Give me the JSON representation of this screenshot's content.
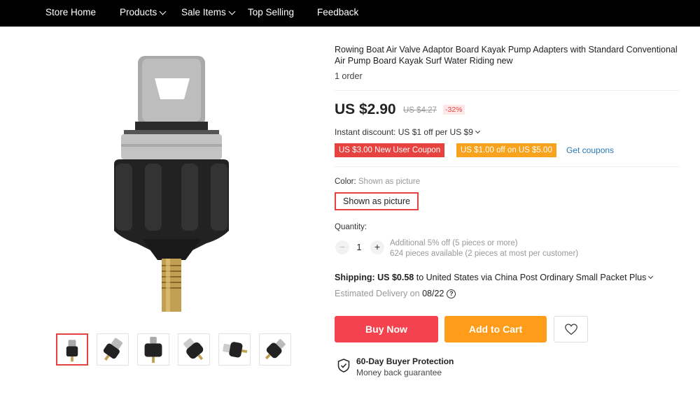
{
  "nav": {
    "items": [
      {
        "label": "Store Home"
      },
      {
        "label": "Products"
      },
      {
        "label": "Sale Items"
      },
      {
        "label": "Top Selling"
      },
      {
        "label": "Feedback"
      }
    ]
  },
  "product": {
    "title": "Rowing Boat Air Valve Adaptor Board Kayak Pump Adapters with Standard Conventional Air Pump Board Kayak Surf Water Riding new",
    "orders": "1 order",
    "price": "US $2.90",
    "old_price": "US $4.27",
    "discount_pct": "-32%",
    "instant_discount": "Instant discount: US $1 off per US $9",
    "coupons": [
      {
        "label": "US $3.00 New User Coupon"
      },
      {
        "label": "US $1.00 off on US $5.00"
      }
    ],
    "get_coupons": "Get coupons",
    "color": {
      "label": "Color: ",
      "value": "Shown as picture",
      "option": "Shown as picture"
    },
    "quantity": {
      "label": "Quantity:",
      "minus": "−",
      "plus": "+",
      "value": "1",
      "note1": "Additional 5% off (5 pieces or more)",
      "note2": "624 pieces available (2 pieces at most per customer)"
    },
    "shipping": {
      "label": "Shipping:",
      "price": "US $0.58",
      "text": "to United States via China Post Ordinary Small Packet Plus"
    },
    "delivery": {
      "label": "Estimated Delivery on",
      "date": "08/22",
      "help": "?"
    },
    "buttons": {
      "buy": "Buy Now",
      "cart": "Add to Cart"
    },
    "protection": {
      "title": "60-Day Buyer Protection",
      "subtitle": "Money back guarantee"
    }
  },
  "colors": {
    "accent": "#e64340",
    "buy": "#f4434f",
    "cart": "#ff9c1a",
    "coupon_orange": "#f7a31e",
    "link": "#2a78b5"
  },
  "icons": [
    "chevron-down-icon",
    "heart-icon",
    "help-icon",
    "shield-check-icon"
  ]
}
